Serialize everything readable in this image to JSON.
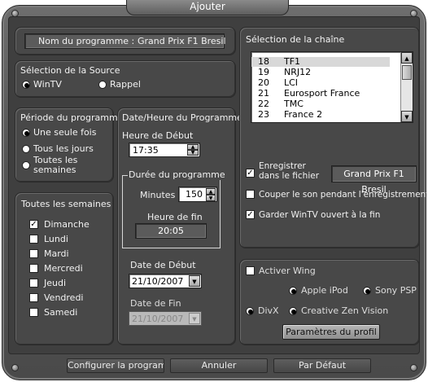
{
  "window": {
    "title": "Ajouter"
  },
  "program_name": {
    "label": "Nom du programme :",
    "value": "Grand Prix F1 Bresil"
  },
  "source": {
    "title": "Sélection de la Source",
    "options": [
      {
        "label": "WinTV",
        "selected": true
      },
      {
        "label": "Rappel",
        "selected": false
      }
    ]
  },
  "period": {
    "title": "Période du programme",
    "options": [
      {
        "label": "Une seule fois",
        "selected": true
      },
      {
        "label": "Tous les jours",
        "selected": false
      },
      {
        "label": "Toutes les semaines",
        "selected": false
      }
    ]
  },
  "weekdays": {
    "title": "Toutes les semaines",
    "days": [
      {
        "label": "Dimanche",
        "checked": true
      },
      {
        "label": "Lundi",
        "checked": false
      },
      {
        "label": "Mardi",
        "checked": false
      },
      {
        "label": "Mercredi",
        "checked": false
      },
      {
        "label": "Jeudi",
        "checked": false
      },
      {
        "label": "Vendredi",
        "checked": false
      },
      {
        "label": "Samedi",
        "checked": false
      }
    ]
  },
  "datetime": {
    "title": "Date/Heure du Programme",
    "start_time_label": "Heure de Début",
    "start_time": "17:35",
    "duration_title": "Durée du programme",
    "minutes_label": "Minutes",
    "minutes": "150",
    "end_time_label": "Heure de fin",
    "end_time": "20:05",
    "start_date_label": "Date de Début",
    "start_date": "21/10/2007",
    "end_date_label": "Date de Fin",
    "end_date": "21/10/2007"
  },
  "channels": {
    "title": "Sélection de la chaîne",
    "items": [
      {
        "num": "18",
        "name": "TF1",
        "selected": true
      },
      {
        "num": "19",
        "name": "NRJ12",
        "selected": false
      },
      {
        "num": "20",
        "name": "LCI",
        "selected": false
      },
      {
        "num": "21",
        "name": "Eurosport France",
        "selected": false
      },
      {
        "num": "22",
        "name": "TMC",
        "selected": false
      },
      {
        "num": "23",
        "name": "France 2",
        "selected": false
      }
    ]
  },
  "record": {
    "save_label_1": "Enregistrer",
    "save_label_2": "dans le fichier",
    "file_name": "Grand Prix F1 Bresil",
    "mute_label": "Couper le son pendant l'enregistrement",
    "keep_open_label": "Garder WinTV ouvert à la fin",
    "save_checked": true,
    "mute_checked": false,
    "keep_open_checked": true
  },
  "wing": {
    "activate_label": "Activer Wing",
    "opt_ipod": "Apple iPod",
    "opt_psp": "Sony PSP",
    "opt_divx": "DivX",
    "opt_zen": "Creative Zen Vision",
    "profile_button": "Paramètres du profil"
  },
  "footer": {
    "configure": "Configurer la programmation",
    "cancel": "Annuler",
    "default": "Par Défaut"
  }
}
